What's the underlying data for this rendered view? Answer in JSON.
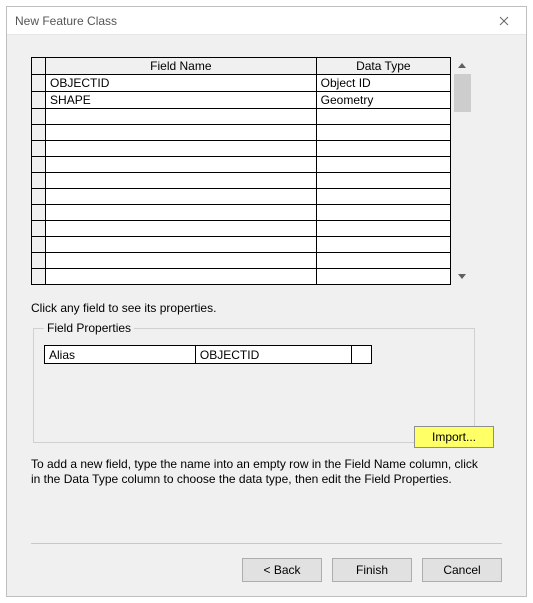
{
  "window": {
    "title": "New Feature Class"
  },
  "grid": {
    "headers": {
      "name": "Field Name",
      "type": "Data Type"
    },
    "rows": [
      {
        "name": "OBJECTID",
        "type": "Object ID"
      },
      {
        "name": "SHAPE",
        "type": "Geometry"
      },
      {
        "name": "",
        "type": ""
      },
      {
        "name": "",
        "type": ""
      },
      {
        "name": "",
        "type": ""
      },
      {
        "name": "",
        "type": ""
      },
      {
        "name": "",
        "type": ""
      },
      {
        "name": "",
        "type": ""
      },
      {
        "name": "",
        "type": ""
      },
      {
        "name": "",
        "type": ""
      },
      {
        "name": "",
        "type": ""
      },
      {
        "name": "",
        "type": ""
      },
      {
        "name": "",
        "type": ""
      }
    ]
  },
  "hint": "Click any field to see its properties.",
  "fieldProps": {
    "legend": "Field Properties",
    "rows": [
      {
        "label": "Alias",
        "value": "OBJECTID"
      }
    ],
    "importLabel": "Import..."
  },
  "paragraph": "To add a new field, type the name into an empty row in the Field Name column, click in the Data Type column to choose the data type, then edit the Field Properties.",
  "footer": {
    "back": "< Back",
    "finish": "Finish",
    "cancel": "Cancel"
  }
}
